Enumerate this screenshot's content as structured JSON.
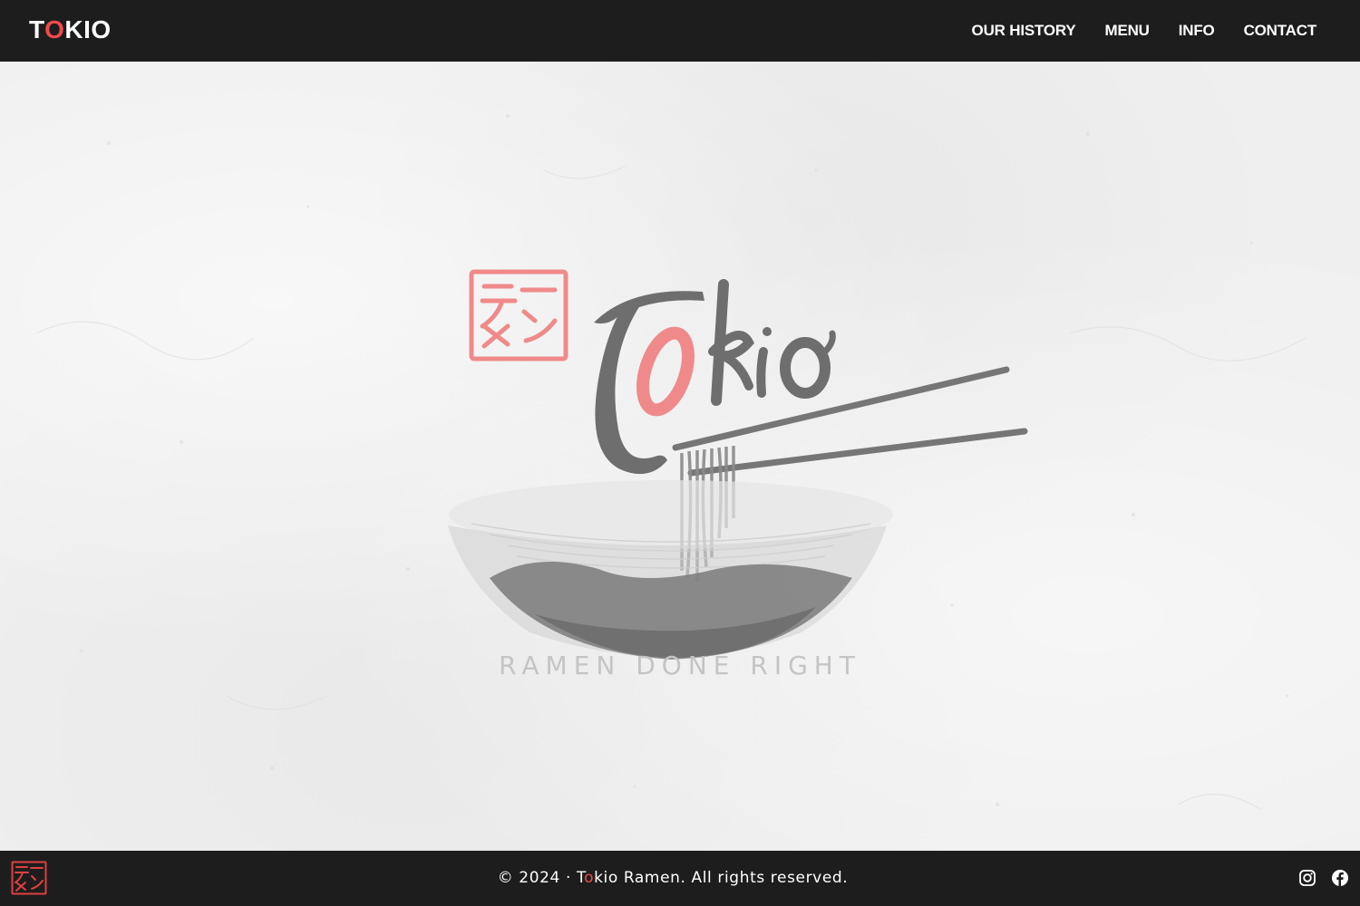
{
  "header": {
    "brand": {
      "first": "T",
      "accent": "O",
      "rest": "KIO"
    },
    "nav": [
      {
        "label": "OUR HISTORY"
      },
      {
        "label": "MENU"
      },
      {
        "label": "INFO"
      },
      {
        "label": "CONTACT"
      }
    ]
  },
  "hero": {
    "logo_text": "Tokio",
    "stamp_text": "ラーメン",
    "tagline": "RAMEN DONE RIGHT"
  },
  "footer": {
    "copyright_prefix": "© 2024 · T",
    "copyright_accent": "o",
    "copyright_suffix": "kio Ramen. All rights reserved.",
    "social": [
      {
        "icon": "instagram-icon"
      },
      {
        "icon": "facebook-icon"
      }
    ]
  },
  "colors": {
    "header_bg": "#1d1d1d",
    "accent": "#f04a4a",
    "ink": "#6e6e6e",
    "stamp": "#f08080"
  }
}
